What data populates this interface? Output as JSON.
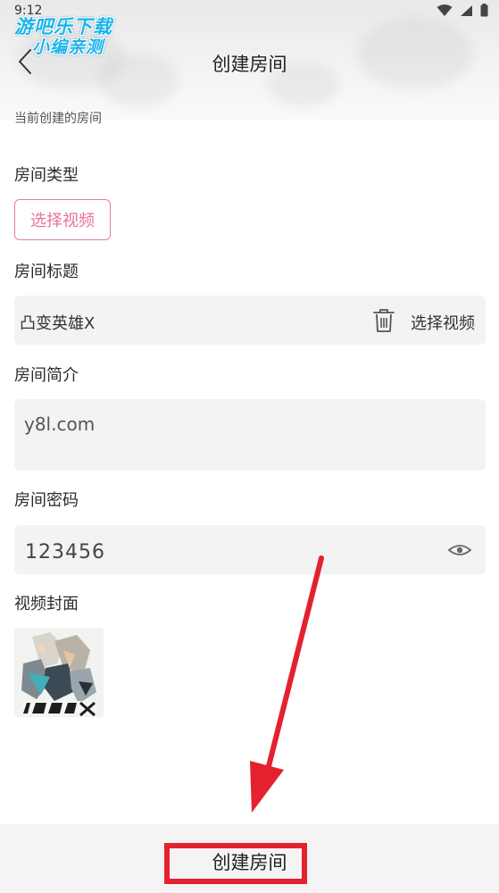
{
  "status_bar": {
    "time": "9:12"
  },
  "watermark": {
    "line1": "游吧乐下载",
    "line2": "小编亲测"
  },
  "header": {
    "title": "创建房间"
  },
  "form": {
    "section_caption": "当前创建的房间",
    "room_type": {
      "label": "房间类型",
      "button_label": "选择视频"
    },
    "room_title": {
      "label": "房间标题",
      "value": "凸变英雄X",
      "action_label": "选择视频"
    },
    "room_intro": {
      "label": "房间简介",
      "value": "y8l.com"
    },
    "room_password": {
      "label": "房间密码",
      "value": "123456"
    },
    "video_cover": {
      "label": "视频封面"
    }
  },
  "footer": {
    "create_label": "创建房间"
  },
  "colors": {
    "accent_pink": "#e8739a",
    "annotation_red": "#e4212f",
    "input_bg": "#f3f3f3",
    "watermark_blue": "#1ab4ea"
  }
}
